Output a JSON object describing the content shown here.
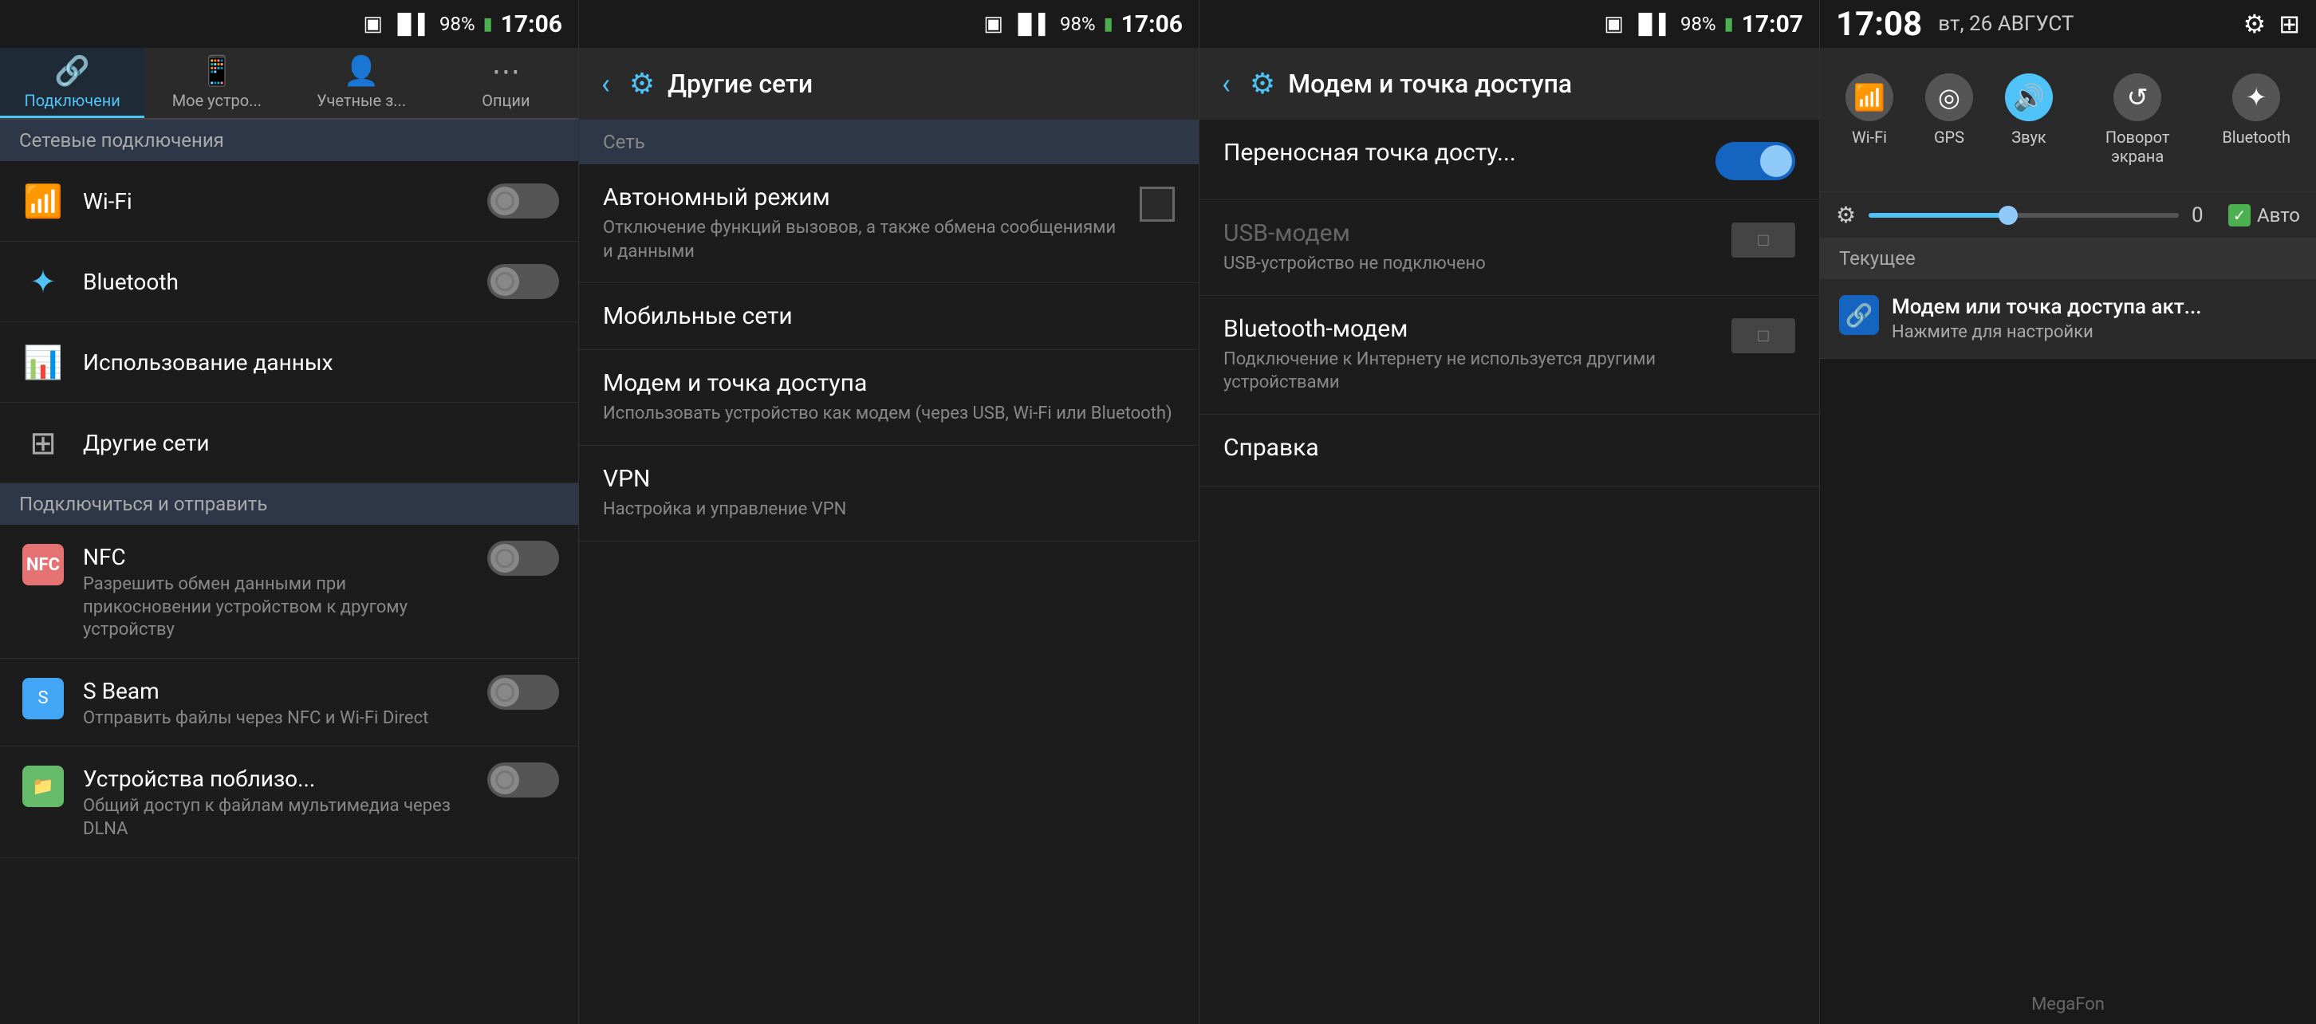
{
  "panel1": {
    "statusBar": {
      "signal": "▐▌▌",
      "battery": "98%",
      "time": "17:06",
      "photoIcon": "▣"
    },
    "tabs": [
      {
        "id": "connections",
        "label": "Подключени",
        "icon": "🔗",
        "active": true
      },
      {
        "id": "my-device",
        "label": "Мое устро...",
        "icon": "📱",
        "active": false
      },
      {
        "id": "accounts",
        "label": "Учетные з...",
        "icon": "👤",
        "active": false
      },
      {
        "id": "options",
        "label": "Опции",
        "icon": "⋯",
        "active": false
      }
    ],
    "sectionHeader": "Сетевые подключения",
    "items": [
      {
        "id": "wifi",
        "icon": "wifi",
        "title": "Wi-Fi",
        "toggle": true,
        "toggleState": "off"
      },
      {
        "id": "bluetooth",
        "icon": "bluetooth",
        "title": "Bluetooth",
        "toggle": true,
        "toggleState": "off"
      },
      {
        "id": "data-usage",
        "icon": "data",
        "title": "Использование данных",
        "toggle": false
      },
      {
        "id": "other-networks",
        "icon": "other",
        "title": "Другие сети",
        "toggle": false
      }
    ],
    "sectionHeader2": "Подключиться и отправить",
    "items2": [
      {
        "id": "nfc",
        "icon": "nfc",
        "title": "NFC",
        "subtitle": "Разрешить обмен данными\nпри прикосновении\nустройством к другому\nустройству",
        "toggle": true,
        "toggleState": "off"
      },
      {
        "id": "sbeam",
        "icon": "sbeam",
        "title": "S Beam",
        "subtitle": "Отправить файлы через NFC\nи Wi-Fi Direct",
        "toggle": true,
        "toggleState": "off"
      },
      {
        "id": "nearby",
        "icon": "nearby",
        "title": "Устройства поблизо...",
        "subtitle": "Общий доступ к файлам\nмультимедиа через DLNA",
        "toggle": true,
        "toggleState": "off"
      }
    ]
  },
  "panel2": {
    "statusBar": {
      "signal": "▐▌▌",
      "battery": "98%",
      "time": "17:06",
      "photoIcon": "▣"
    },
    "header": {
      "title": "Другие сети",
      "backLabel": "‹",
      "gearIcon": "⚙"
    },
    "netSectionLabel": "Сеть",
    "items": [
      {
        "id": "airplane",
        "title": "Автономный режим",
        "subtitle": "Отключение функций вызовов, а также обмена сообщениями и данными",
        "hasCheckbox": true
      },
      {
        "id": "mobile-nets",
        "title": "Мобильные сети",
        "subtitle": "",
        "hasCheckbox": false
      },
      {
        "id": "modem-hotspot",
        "title": "Модем и точка доступа",
        "subtitle": "Использовать устройство как модем (через USB, Wi-Fi или Bluetooth)",
        "hasCheckbox": false
      },
      {
        "id": "vpn",
        "title": "VPN",
        "subtitle": "Настройка и управление VPN",
        "hasCheckbox": false
      }
    ]
  },
  "panel3": {
    "statusBar": {
      "signal": "▐▌▌",
      "battery": "98%",
      "time": "17:07",
      "photoIcon": "▣"
    },
    "header": {
      "title": "Модем и точка доступа",
      "backLabel": "‹",
      "gearIcon": "⚙"
    },
    "items": [
      {
        "id": "portable-hotspot",
        "title": "Переносная точка досту...",
        "subtitle": "",
        "toggleType": "blue",
        "toggleOn": true
      },
      {
        "id": "usb-modem",
        "title": "USB-модем",
        "subtitle": "USB-устройство не подключено",
        "toggleType": "gray",
        "toggleOn": false
      },
      {
        "id": "bluetooth-modem",
        "title": "Bluetooth-модем",
        "subtitle": "Подключение к Интернету не используется другими устройствами",
        "toggleType": "gray",
        "toggleOn": false
      },
      {
        "id": "help",
        "title": "Справка",
        "subtitle": "",
        "toggleType": "none"
      }
    ]
  },
  "panel4": {
    "statusBar": {
      "time": "17:08",
      "date": "вт, 26 АВГУСТ"
    },
    "topIcons": {
      "gear": "⚙",
      "grid": "⊞"
    },
    "quickSettings": [
      {
        "id": "wifi",
        "icon": "📶",
        "label": "Wi-Fi",
        "active": false
      },
      {
        "id": "gps",
        "icon": "◎",
        "label": "GPS",
        "active": false
      },
      {
        "id": "sound",
        "icon": "🔊",
        "label": "Звук",
        "active": true
      },
      {
        "id": "rotate",
        "icon": "↺",
        "label": "Поворот экрана",
        "active": false
      },
      {
        "id": "bluetooth",
        "icon": "⚡",
        "label": "Bluetooth",
        "active": false
      }
    ],
    "brightness": {
      "gearIcon": "⚙",
      "value": "0",
      "autoLabel": "Авто",
      "sliderPercent": 45
    },
    "currentHeader": "Текущее",
    "notifications": [
      {
        "id": "tethering",
        "icon": "🔗",
        "title": "Модем или точка доступа акт...",
        "body": "Нажмите для настройки"
      }
    ],
    "carrier": "MegaFon"
  }
}
